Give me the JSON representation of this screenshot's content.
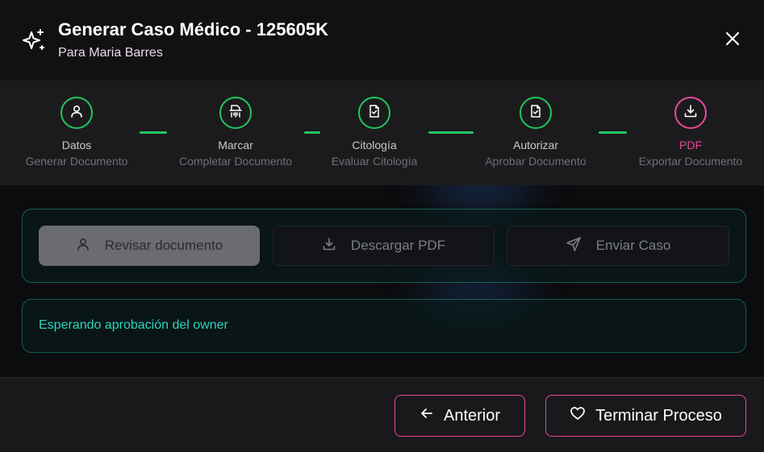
{
  "header": {
    "title": "Generar Caso Médico - 125605K",
    "subtitle": "Para Maria Barres",
    "icon": "sparkles-icon",
    "close_icon": "close-icon"
  },
  "stepper": {
    "steps": [
      {
        "label": "Datos",
        "sub": "Generar Documento",
        "icon": "user-icon",
        "state": "completed"
      },
      {
        "label": "Marcar",
        "sub": "Completar Documento",
        "icon": "shredder-icon",
        "state": "completed"
      },
      {
        "label": "Citología",
        "sub": "Evaluar Citología",
        "icon": "file-check-icon",
        "state": "completed"
      },
      {
        "label": "Autorizar",
        "sub": "Aprobar Documento",
        "icon": "file-check-icon",
        "state": "completed"
      },
      {
        "label": "PDF",
        "sub": "Exportar Documento",
        "icon": "download-icon",
        "state": "active"
      }
    ],
    "colors": {
      "completed": "#22c55e",
      "active": "#ec4899"
    }
  },
  "actions": {
    "review": {
      "label": "Revisar documento",
      "icon": "user-icon"
    },
    "download": {
      "label": "Descargar PDF",
      "icon": "download-icon"
    },
    "send": {
      "label": "Enviar Caso",
      "icon": "send-icon"
    }
  },
  "status": {
    "text": "Esperando aprobación del owner",
    "color": "#2dd4bf"
  },
  "footer": {
    "previous": {
      "label": "Anterior",
      "icon": "arrow-left-icon"
    },
    "finish": {
      "label": "Terminar Proceso",
      "icon": "heart-icon"
    },
    "accent": "#ec4899"
  }
}
